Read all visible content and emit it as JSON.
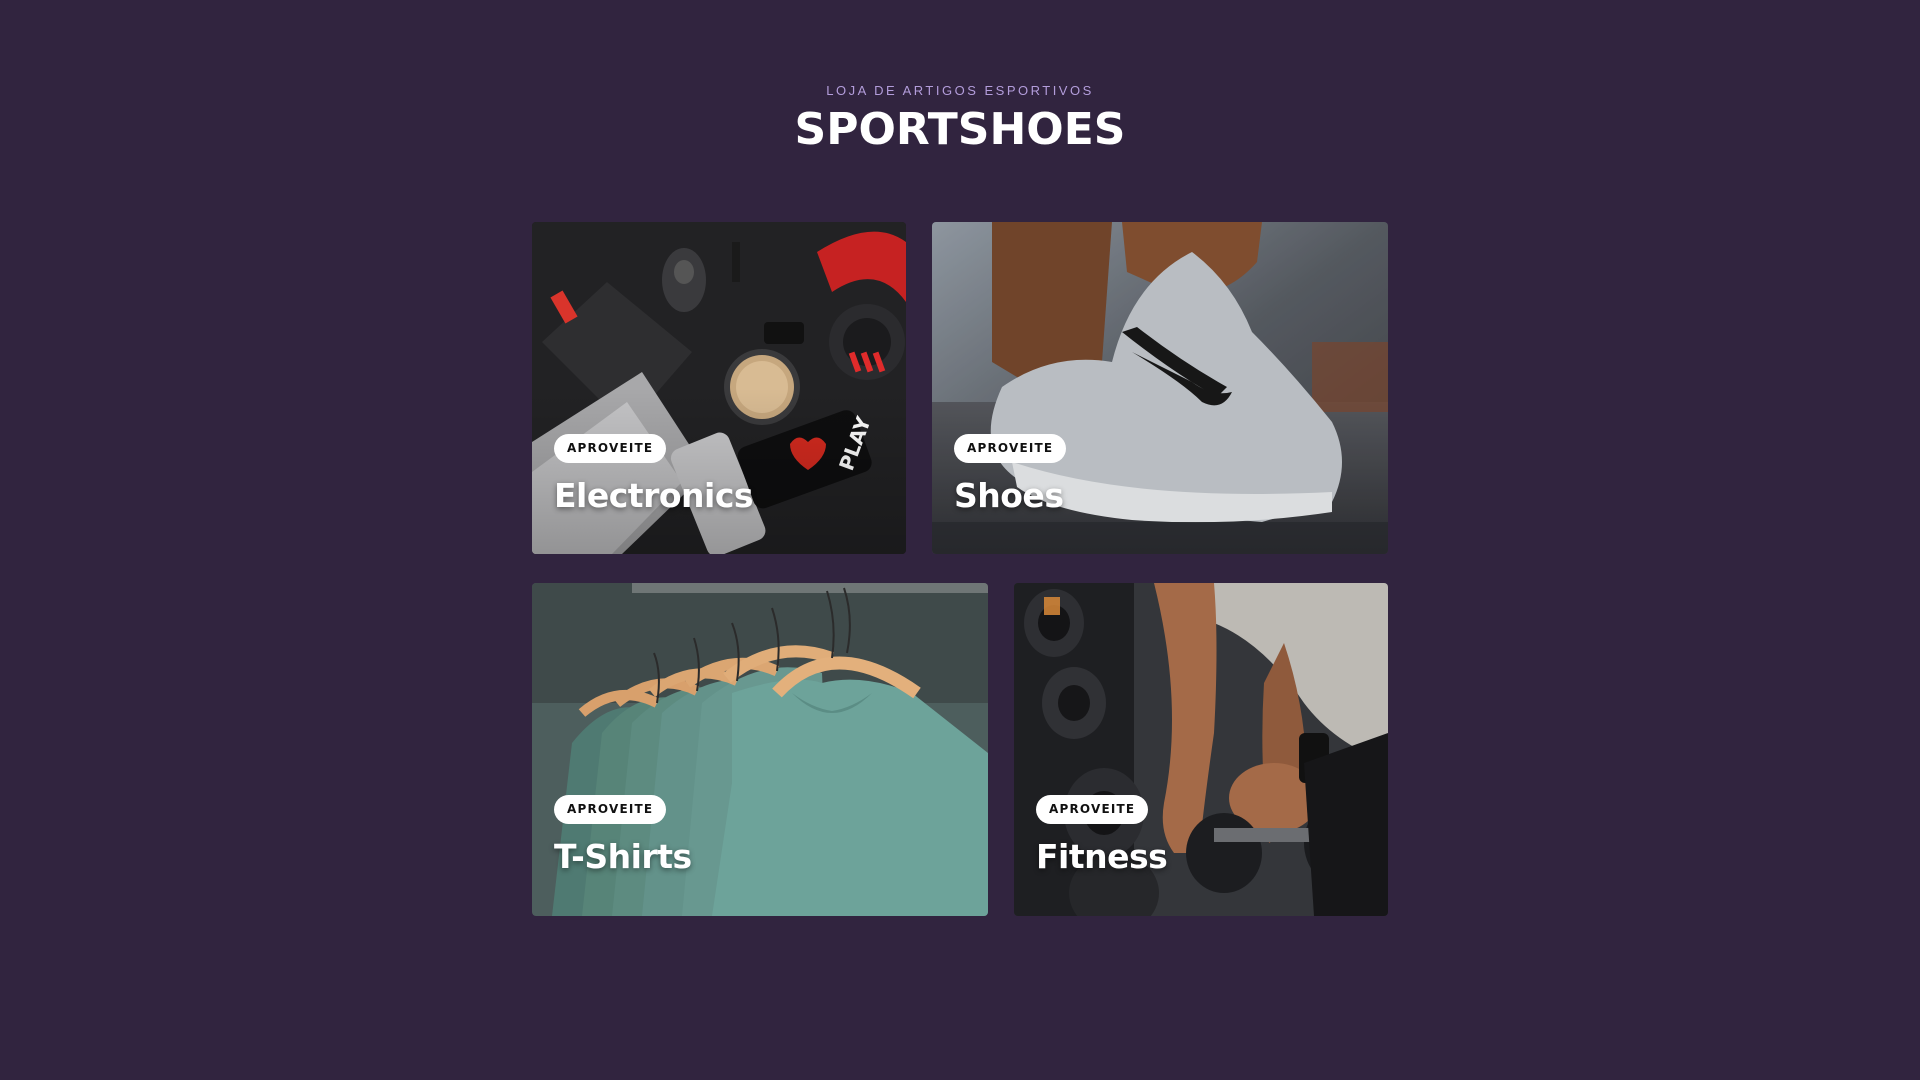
{
  "header": {
    "subtitle": "LOJA DE ARTIGOS ESPORTIVOS",
    "title": "SPORTSHOES"
  },
  "cards": [
    {
      "badge": "APROVEITE",
      "label": "Electronics",
      "image": "electronics-photo"
    },
    {
      "badge": "APROVEITE",
      "label": "Shoes",
      "image": "sneaker-photo"
    },
    {
      "badge": "APROVEITE",
      "label": "T-Shirts",
      "image": "tshirts-on-hangers-photo"
    },
    {
      "badge": "APROVEITE",
      "label": "Fitness",
      "image": "dumbbells-photo"
    }
  ],
  "colors": {
    "background": "#31243f",
    "subtitle": "#b39ddb",
    "title": "#ffffff",
    "badge_bg": "#ffffff"
  }
}
